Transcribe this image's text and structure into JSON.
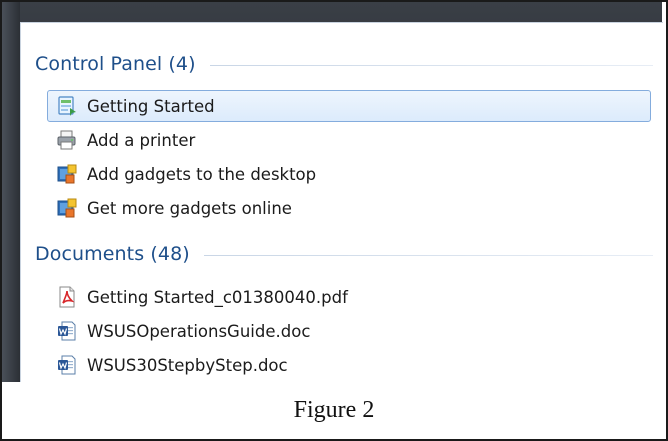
{
  "control_panel": {
    "title": "Control Panel (4)",
    "items": [
      {
        "label": "Getting Started",
        "icon": "getting-started-icon",
        "selected": true
      },
      {
        "label": "Add a printer",
        "icon": "printer-icon",
        "selected": false
      },
      {
        "label": "Add gadgets to the desktop",
        "icon": "gadgets-icon",
        "selected": false
      },
      {
        "label": "Get more gadgets online",
        "icon": "gadgets-icon",
        "selected": false
      }
    ]
  },
  "documents": {
    "title": "Documents (48)",
    "items": [
      {
        "label": "Getting Started_c01380040.pdf",
        "icon": "pdf-icon"
      },
      {
        "label": "WSUSOperationsGuide.doc",
        "icon": "word-doc-icon"
      },
      {
        "label": "WSUS30StepbyStep.doc",
        "icon": "word-doc-icon"
      }
    ]
  },
  "caption": "Figure 2",
  "colors": {
    "group_header": "#1e4f8a",
    "selection_fill": "#dcebfc",
    "selection_border": "#84acdd",
    "bezel": "#262a30"
  }
}
